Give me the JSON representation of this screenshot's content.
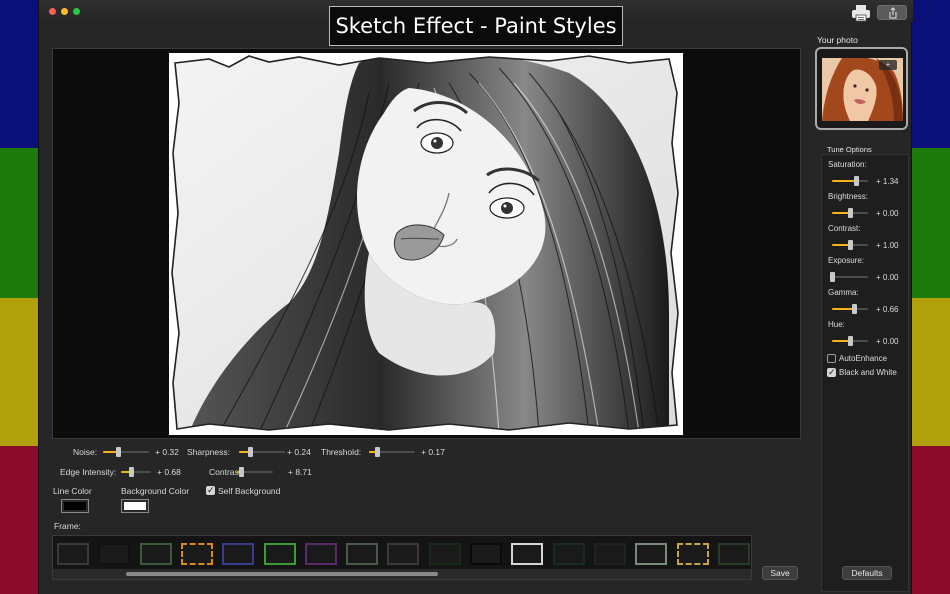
{
  "window": {
    "title": "Sketch Effect - Paint Styles"
  },
  "toolbar": {
    "print_icon": "printer-icon",
    "share_icon": "share-icon"
  },
  "effects": {
    "noise": {
      "label": "Noise:",
      "value": "+ 0.32",
      "level": 0.32
    },
    "sharpness": {
      "label": "Sharpness:",
      "value": "+ 0.24",
      "level": 0.24
    },
    "threshold": {
      "label": "Threshold:",
      "value": "+ 0.17",
      "level": 0.17
    },
    "edge_intensity": {
      "label": "Edge Intensity:",
      "value": "+ 0.68",
      "level": 0.32
    },
    "contrast": {
      "label": "Contrast:",
      "value": "+ 8.71",
      "level": 0.1
    }
  },
  "colors": {
    "line_color_label": "Line Color",
    "line_color": "#000000",
    "background_color_label": "Background Color",
    "background_color": "#ffffff",
    "self_background_label": "Self Background",
    "self_background_checked": true
  },
  "frames": {
    "label": "Frame:",
    "items": [
      {
        "style": "dark",
        "color": "#3a3a3a"
      },
      {
        "style": "black",
        "color": "#111111"
      },
      {
        "style": "green",
        "color": "#3a5a3a"
      },
      {
        "style": "orange-ornate",
        "color": "#d98a1a"
      },
      {
        "style": "blue",
        "color": "#3a3a8a"
      },
      {
        "style": "rainbow",
        "color": "#3a9a3a"
      },
      {
        "style": "purple",
        "color": "#5a2a6a"
      },
      {
        "style": "gray",
        "color": "#4a5a4a"
      },
      {
        "style": "dark-gray",
        "color": "#3a3a3a"
      },
      {
        "style": "black-green",
        "color": "#1a2a1a"
      },
      {
        "style": "black-bold",
        "color": "#0a0a0a"
      },
      {
        "style": "white",
        "color": "#d6d6d6"
      },
      {
        "style": "dark-teal",
        "color": "#1a2a2a"
      },
      {
        "style": "shadow",
        "color": "#1e241e"
      },
      {
        "style": "silver",
        "color": "#7a8a7a"
      },
      {
        "style": "gold-ornate",
        "color": "#c9a24a"
      },
      {
        "style": "dark-edge",
        "color": "#2a3a2a"
      }
    ]
  },
  "actions": {
    "save_label": "Save",
    "defaults_label": "Defaults"
  },
  "sidebar": {
    "your_photo_label": "Your photo",
    "add_label": "+",
    "tune_options_label": "Tune Options",
    "tune": [
      {
        "label": "Saturation:",
        "value": "+ 1.34",
        "level": 0.67
      },
      {
        "label": "Brightness:",
        "value": "+ 0.00",
        "level": 0.5
      },
      {
        "label": "Contrast:",
        "value": "+ 1.00",
        "level": 0.5
      },
      {
        "label": "Exposure:",
        "value": "+ 0.00",
        "level": 0.0
      },
      {
        "label": "Gamma:",
        "value": "+ 0.66",
        "level": 0.62
      },
      {
        "label": "Hue:",
        "value": "+ 0.00",
        "level": 0.5
      }
    ],
    "auto_enhance": {
      "label": "AutoEnhance",
      "checked": false
    },
    "black_and_white": {
      "label": "Black and White",
      "checked": true
    }
  },
  "accent_color": "#f5b21a"
}
